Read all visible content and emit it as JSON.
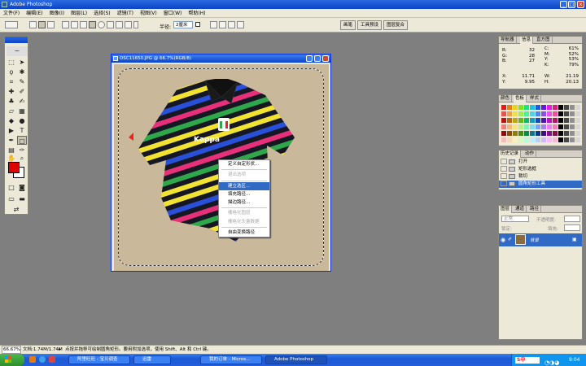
{
  "app": {
    "title": "Adobe Photoshop"
  },
  "menu": [
    "文件(F)",
    "编辑(E)",
    "图像(I)",
    "图层(L)",
    "选择(S)",
    "滤镜(T)",
    "视图(V)",
    "窗口(W)",
    "帮助(H)"
  ],
  "options": {
    "feather_label": "半径:",
    "feather_value": "2厘米",
    "antialias_label": "消除锯齿"
  },
  "wells": [
    "画笔",
    "工具预设",
    "图层复合"
  ],
  "document": {
    "title": "DSC11650.JPG @ 66.7%(RGB/8)"
  },
  "context_menu": {
    "items": [
      {
        "label": "定义自定形状...",
        "disabled": false,
        "highlighted": false
      },
      {
        "label": "退出选项",
        "disabled": true,
        "highlighted": false
      },
      {
        "label": "建立选区...",
        "disabled": false,
        "highlighted": true
      },
      {
        "label": "填充路径...",
        "disabled": false,
        "highlighted": false
      },
      {
        "label": "描边路径...",
        "disabled": false,
        "highlighted": false
      },
      {
        "label": "栅格化图层",
        "disabled": true,
        "highlighted": false
      },
      {
        "label": "栅格化矢量数据",
        "disabled": true,
        "highlighted": false
      },
      {
        "label": "自由变换路径",
        "disabled": false,
        "highlighted": false
      }
    ]
  },
  "navigator": {
    "tabs": [
      "导航器",
      "信息",
      "直方图"
    ],
    "r": "32",
    "g": "28",
    "b": "27",
    "c": "61%",
    "m": "52%",
    "y": "53%",
    "k": "79%",
    "x": "11.71",
    "yy": "9.95",
    "w": "21.19",
    "h": "20.13"
  },
  "swatches": {
    "tabs": [
      "颜色",
      "色板",
      "样式"
    ]
  },
  "history": {
    "tabs": [
      "历史记录",
      "动作"
    ],
    "items": [
      "打开",
      "矩形选框",
      "裁切",
      "圆角矩形工具"
    ]
  },
  "layers": {
    "tabs": [
      "图层",
      "通道",
      "路径"
    ],
    "blend": "正常",
    "opacity_label": "不透明度:",
    "lock_label": "锁定:",
    "fill_label": "填充:",
    "layer_name": "背景"
  },
  "status": {
    "zoom": "66.67%",
    "doc": "文档:1.74M/1.74M",
    "hint": "点按并拖移可绘制圆角矩形。要用附加选项，使用 Shift、Alt 和 Ctrl 键。"
  },
  "taskbar": {
    "tasks": [
      "阿里旺旺 - 宝贝调查",
      "迅雷",
      "我的订单 - Micros...",
      "Adobe Photoshop"
    ],
    "time": "9:04"
  },
  "colors": {
    "foreground": "#e00000",
    "highlight": "#316ac5"
  }
}
